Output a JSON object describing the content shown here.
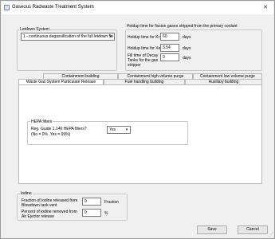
{
  "window": {
    "title": "Gaseous Radwaste Treatment System",
    "close_glyph": "✕"
  },
  "letdown": {
    "group_label": "Letdown System",
    "selected_option": "1 - continuous degassification of the full letdown flo"
  },
  "holdup": {
    "group_label": "Holdup time for fission gases stripped from the primary coolant",
    "kr_label": "Holdup time for Kr",
    "kr_value": "60",
    "kr_unit": "days",
    "xe_label": "Holdup time for Xe",
    "xe_value": "3.54",
    "xe_unit": "days",
    "fill_label": "Fill time of Decay Tanks for the gas stripper",
    "fill_value": "0",
    "fill_unit": "days"
  },
  "tabs": {
    "row1": [
      {
        "label": "Containment building"
      },
      {
        "label": "Containment high volume purge"
      },
      {
        "label": "Containment low volume purge"
      }
    ],
    "row2": [
      {
        "label": "Waste Gas System Particulate Release"
      },
      {
        "label": "Fuel handling building"
      },
      {
        "label": "Auxiliary building"
      }
    ]
  },
  "hepa": {
    "group_label": "HEPA filters",
    "question_line1": "Reg. Guide 1.140 HEPA filters?",
    "question_line2": "(No = 0% ,Yes = 99%)",
    "selected_option": "Yes"
  },
  "iodine": {
    "group_label": "Iodine",
    "blowdown_label": "Fraction of iodine released from Blowdown tank vent",
    "blowdown_value": "0",
    "blowdown_unit": "Fraction",
    "ejector_label": "Percent of iodine removed from Air Ejector release",
    "ejector_value": "0",
    "ejector_unit": "%"
  },
  "buttons": {
    "save": "Save",
    "cancel": "Cancel"
  },
  "icons": {
    "app": "app-icon",
    "dropdown": "chevron-down-icon",
    "resize": "resize-grip-icon"
  }
}
